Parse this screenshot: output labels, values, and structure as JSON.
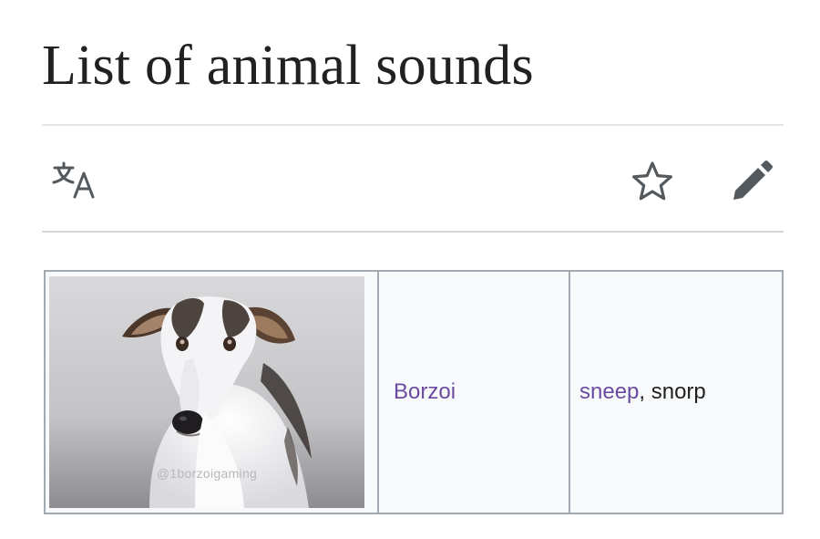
{
  "page": {
    "title": "List of animal sounds"
  },
  "toolbar": {
    "icons": [
      "translate-icon",
      "star-icon",
      "edit-icon"
    ]
  },
  "table": {
    "rows": [
      {
        "image": {
          "subject": "borzoi dog photo",
          "watermark": "@1borzoigaming"
        },
        "animal": "Borzoi",
        "sounds": [
          {
            "text": "sneep",
            "is_link": true
          },
          {
            "text": "snorp",
            "is_link": false
          }
        ],
        "separator": ", "
      }
    ]
  },
  "colors": {
    "link": "#6b4ba1",
    "text": "#202122",
    "cell_background": "#f8f9fa",
    "border": "#a2a9b1"
  }
}
